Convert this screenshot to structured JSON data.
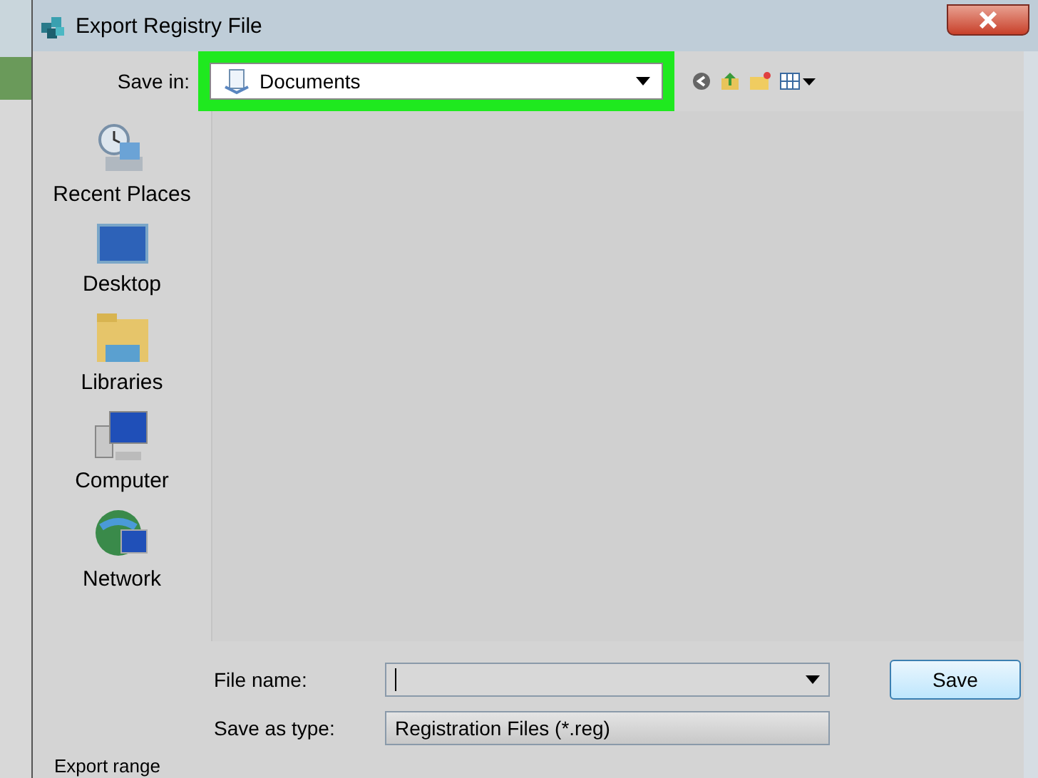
{
  "window": {
    "title": "Export Registry File"
  },
  "save_in": {
    "label": "Save in:",
    "value": "Documents",
    "highlighted": true
  },
  "places": [
    {
      "label": "Recent Places",
      "kind": "recent"
    },
    {
      "label": "Desktop",
      "kind": "desktop"
    },
    {
      "label": "Libraries",
      "kind": "libraries"
    },
    {
      "label": "Computer",
      "kind": "computer"
    },
    {
      "label": "Network",
      "kind": "network"
    }
  ],
  "file_name": {
    "label": "File name:"
  },
  "save_as_type": {
    "label": "Save as type:",
    "value": "Registration Files (*.reg)"
  },
  "buttons": [
    "Save"
  ],
  "export_range": {
    "label": "Export range"
  }
}
